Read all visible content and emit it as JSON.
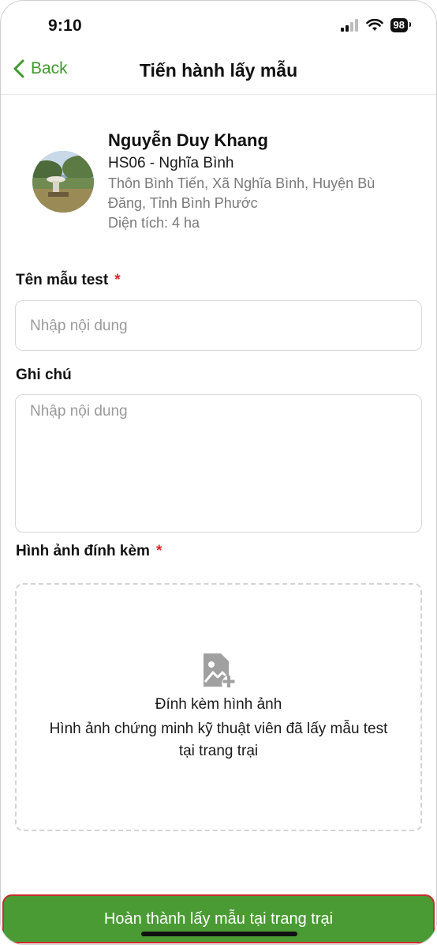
{
  "status": {
    "time": "9:10",
    "battery": "98"
  },
  "nav": {
    "back_label": "Back",
    "title": "Tiến hành lấy mẫu"
  },
  "profile": {
    "name": "Nguyễn Duy Khang",
    "code": "HS06 - Nghĩa Bình",
    "address": "Thôn Bình Tiến, Xã Nghĩa Bình, Huyện Bù Đăng, Tỉnh Bình Phước",
    "area": "Diện tích: 4 ha"
  },
  "form": {
    "sample_name": {
      "label": "Tên mẫu test",
      "required_mark": "*",
      "placeholder": "Nhập nội dung",
      "value": ""
    },
    "note": {
      "label": "Ghi chú",
      "placeholder": "Nhập nội dung",
      "value": ""
    },
    "attachment": {
      "label": "Hình ảnh đính kèm",
      "required_mark": "*",
      "upload_title": "Đính kèm hình ảnh",
      "upload_description": "Hình ảnh chứng minh kỹ thuật viên đã lấy mẫu test tại trang trại",
      "icon": "image-add-icon"
    }
  },
  "actions": {
    "submit_label": "Hoàn thành lấy mẫu tại trang trại"
  },
  "colors": {
    "accent": "#3e9a2c",
    "button": "#4b9b35",
    "required": "#d62b2b"
  }
}
